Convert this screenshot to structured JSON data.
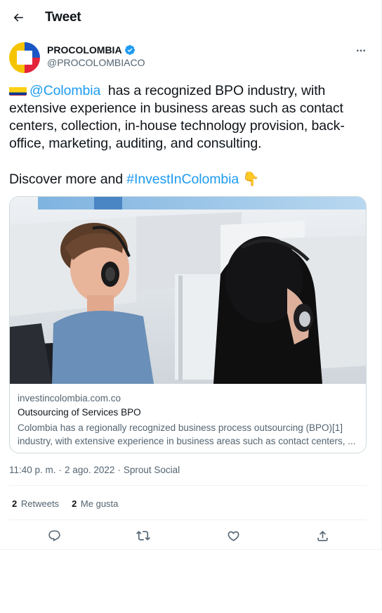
{
  "header": {
    "title": "Tweet"
  },
  "author": {
    "name": "PROCOLOMBIA",
    "handle": "@PROCOLOMBIACO",
    "verified": true
  },
  "tweet": {
    "mention": "@Colombia",
    "line1_rest": "  has a recognized BPO industry, with extensive experience in business areas such as contact centers, collection, in-house technology provision, back-office, marketing, auditing, and consulting.",
    "line2_prefix": "Discover more and ",
    "hashtag": "#InvestInColombia",
    "emoji": "👇"
  },
  "card": {
    "domain": "investincolombia.com.co",
    "title": "Outsourcing of Services BPO",
    "description": "Colombia has a regionally recognized business process outsourcing (BPO)[1] industry, with extensive experience in business areas such as contact centers, ..."
  },
  "meta": {
    "time": "11:40 p. m.",
    "sep1": "·",
    "date": "2 ago. 2022",
    "sep2": "·",
    "source": "Sprout Social"
  },
  "stats": [
    {
      "count": "2",
      "label": "Retweets"
    },
    {
      "count": "2",
      "label": "Me gusta"
    }
  ],
  "icons": {
    "back": "arrow-left-icon",
    "verified": "verified-badge-icon",
    "more": "more-horizontal-icon",
    "reply": "reply-icon",
    "retweet": "retweet-icon",
    "like": "heart-icon",
    "share": "share-icon"
  },
  "colors": {
    "accent": "#1d9bf0",
    "text": "#0f1419",
    "secondary": "#536471",
    "border": "#cfd9de"
  }
}
